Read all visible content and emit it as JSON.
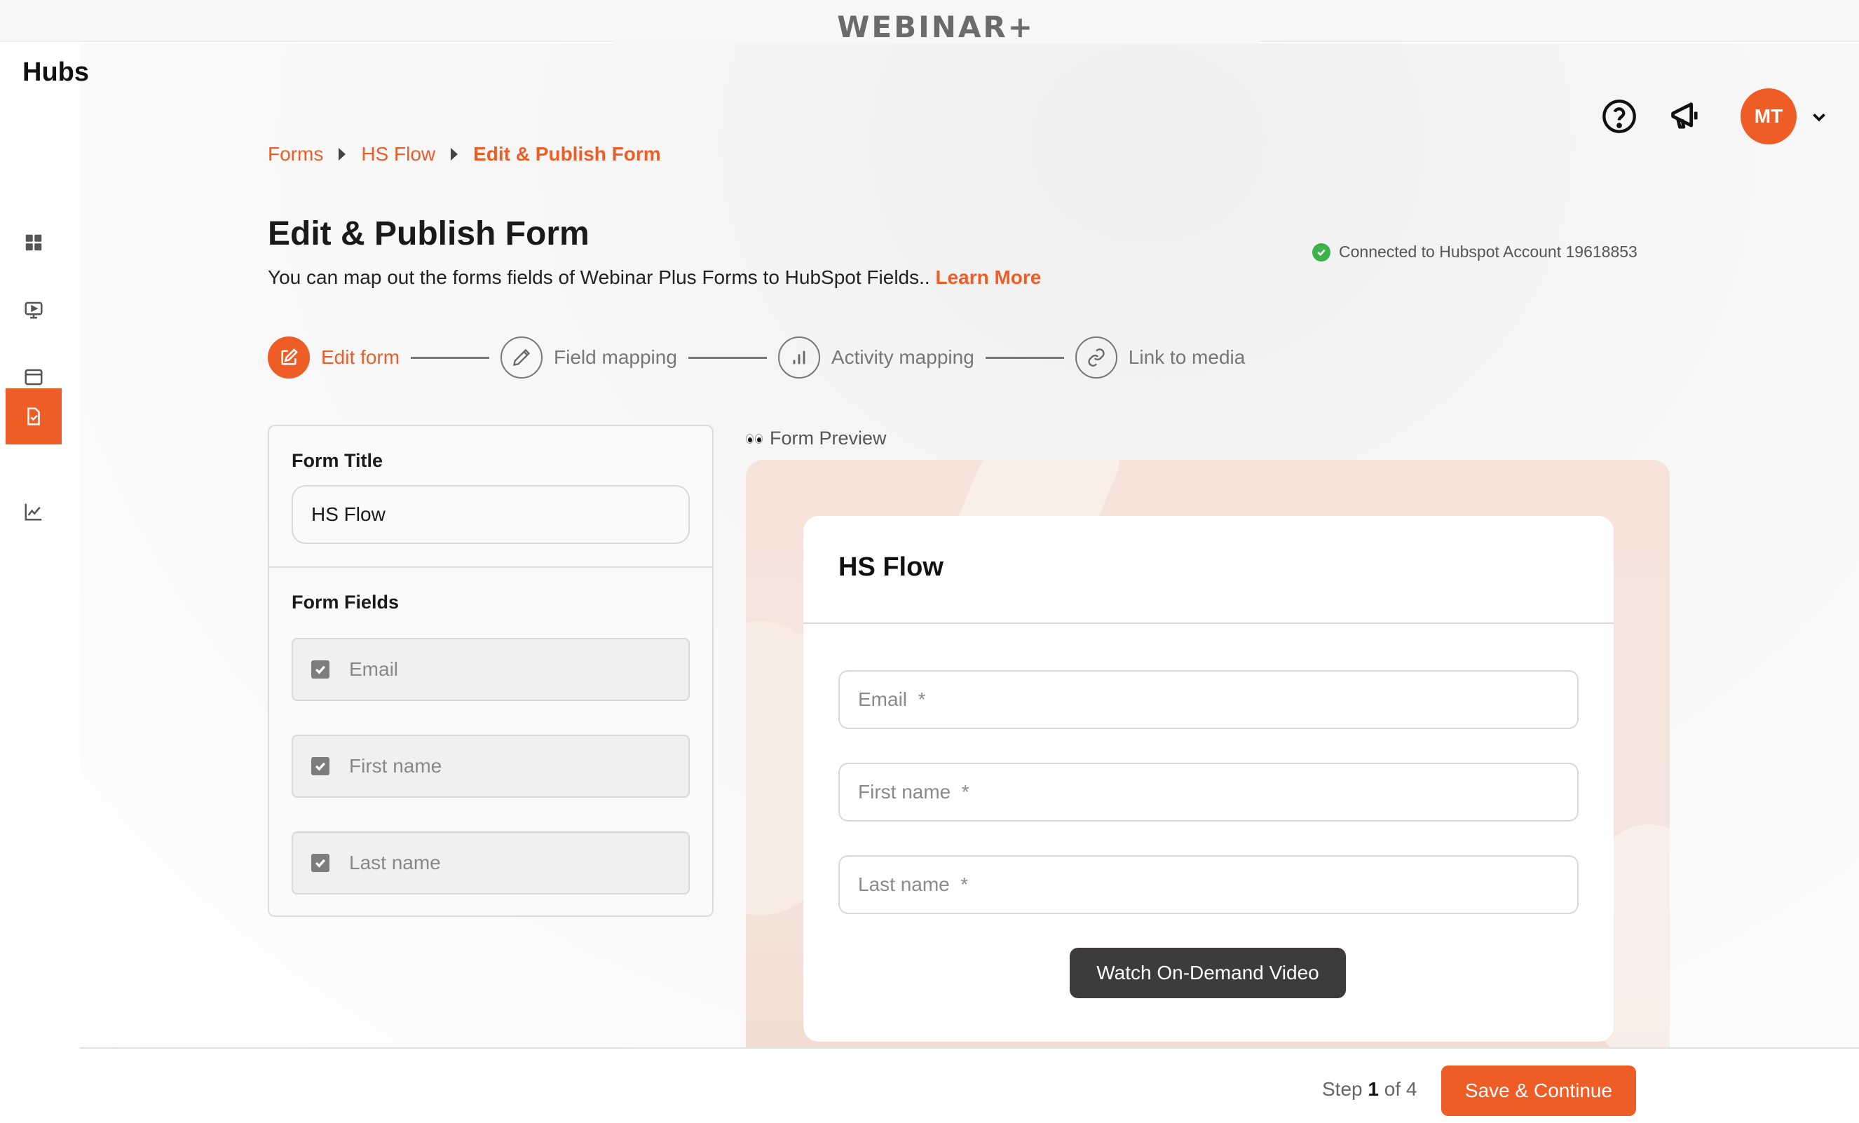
{
  "app": {
    "brand": "WEBINAR+"
  },
  "sidebar": {
    "title": "Hubs",
    "items": [
      {
        "name": "dashboard",
        "icon": "grid-icon"
      },
      {
        "name": "webinars",
        "icon": "monitor-play-icon"
      },
      {
        "name": "pages",
        "icon": "browser-window-icon"
      },
      {
        "name": "forms",
        "icon": "document-check-icon",
        "active": true
      },
      {
        "name": "analytics",
        "icon": "line-chart-icon"
      }
    ]
  },
  "header": {
    "help_icon": "help-circle-icon",
    "announce_icon": "megaphone-icon",
    "avatar_initials": "MT",
    "avatar_color": "#ef5d27"
  },
  "breadcrumb": [
    "Forms",
    "HS Flow",
    "Edit & Publish Form"
  ],
  "page": {
    "title": "Edit & Publish Form",
    "subtitle": "You can map out the forms fields of Webinar Plus Forms to HubSpot Fields..",
    "learn_more": "Learn More",
    "connected_text": "Connected to Hubspot Account 19618853"
  },
  "stepper": {
    "steps": [
      {
        "label": "Edit form",
        "icon": "edit-square-icon",
        "active": true
      },
      {
        "label": "Field mapping",
        "icon": "pencil-icon"
      },
      {
        "label": "Activity mapping",
        "icon": "bar-chart-icon"
      },
      {
        "label": "Link to media",
        "icon": "link-icon"
      }
    ]
  },
  "form_editor": {
    "title_label": "Form Title",
    "title_value": "HS Flow",
    "fields_label": "Form Fields",
    "fields": [
      {
        "label": "Email",
        "checked": true
      },
      {
        "label": "First name",
        "checked": true
      },
      {
        "label": "Last name",
        "checked": true
      }
    ]
  },
  "preview": {
    "label": "Form Preview",
    "form_title": "HS Flow",
    "inputs": [
      {
        "placeholder": "Email  *"
      },
      {
        "placeholder": "First name  *"
      },
      {
        "placeholder": "Last name  *"
      }
    ],
    "button": "Watch On-Demand Video"
  },
  "footer": {
    "step_prefix": "Step",
    "step_current": "1",
    "step_suffix": "of 4",
    "save_button": "Save & Continue"
  },
  "colors": {
    "accent": "#ef5d27",
    "success": "#3db24a",
    "dark_button": "#3d3b3b"
  }
}
